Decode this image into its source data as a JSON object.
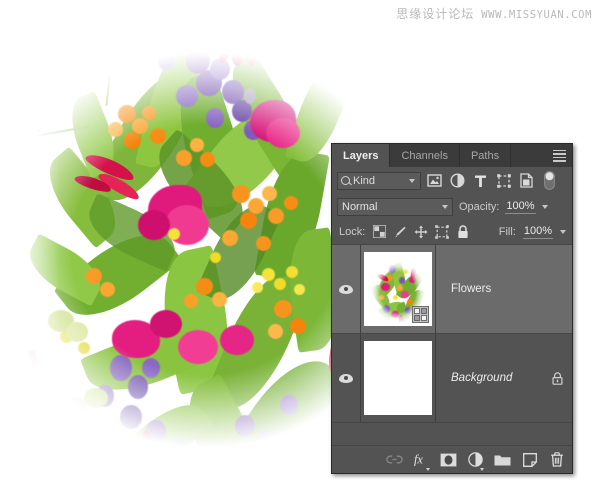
{
  "watermark": {
    "chinese": "思缘设计论坛",
    "url": "WWW.MISSYUAN.COM"
  },
  "photo": {
    "description": "Colorful flower bouquet on white background",
    "subject": "Flowers"
  },
  "panel": {
    "tabs": [
      {
        "label": "Layers",
        "active": true
      },
      {
        "label": "Channels",
        "active": false
      },
      {
        "label": "Paths",
        "active": false
      }
    ],
    "menu_icon": "hamburger-menu-icon",
    "filter": {
      "kind_label": "Kind",
      "search_icon": "magnifier-icon",
      "type_filters": [
        {
          "name": "pixel-layer-filter",
          "icon": "image-icon"
        },
        {
          "name": "adjustment-layer-filter",
          "icon": "adjustment-icon"
        },
        {
          "name": "type-layer-filter",
          "icon": "type-t-icon"
        },
        {
          "name": "shape-layer-filter",
          "icon": "shape-icon"
        },
        {
          "name": "smart-object-filter",
          "icon": "smart-object-icon"
        }
      ],
      "toggle_name": "filter-enable-toggle"
    },
    "blend": {
      "mode": "Normal",
      "opacity_label": "Opacity:",
      "opacity_value": "100%"
    },
    "lock": {
      "label": "Lock:",
      "buttons": [
        {
          "name": "lock-transparent-pixels",
          "icon": "checkerboard-icon"
        },
        {
          "name": "lock-image-pixels",
          "icon": "brush-icon"
        },
        {
          "name": "lock-position",
          "icon": "move-arrows-icon"
        },
        {
          "name": "lock-artboard-nesting",
          "icon": "artboard-icon"
        },
        {
          "name": "lock-all",
          "icon": "padlock-icon"
        }
      ],
      "fill_label": "Fill:",
      "fill_value": "100%"
    },
    "layers": [
      {
        "name": "Flowers",
        "visible": true,
        "selected": true,
        "italic": false,
        "locked": false,
        "smart_object": true,
        "thumbnail": "flower-bouquet-thumbnail"
      },
      {
        "name": "Background",
        "visible": true,
        "selected": false,
        "italic": true,
        "locked": true,
        "smart_object": false,
        "thumbnail": "white-thumbnail"
      }
    ],
    "bottom_buttons": [
      {
        "name": "link-layers-button",
        "icon": "link-icon",
        "disabled": true
      },
      {
        "name": "layer-style-button",
        "icon": "fx-icon",
        "disabled": false
      },
      {
        "name": "add-layer-mask-button",
        "icon": "mask-icon",
        "disabled": false
      },
      {
        "name": "new-adjustment-layer-button",
        "icon": "adjustment-icon",
        "disabled": false
      },
      {
        "name": "new-group-button",
        "icon": "folder-icon",
        "disabled": false
      },
      {
        "name": "new-layer-button",
        "icon": "new-layer-icon",
        "disabled": false
      },
      {
        "name": "delete-layer-button",
        "icon": "trash-icon",
        "disabled": false
      }
    ]
  },
  "colors": {
    "panel_bg": "#535353",
    "panel_tab_bg": "#3b3b3b",
    "selected_row": "#6b6b6b",
    "text": "#d6d6d6",
    "border": "#2a2a2a"
  }
}
